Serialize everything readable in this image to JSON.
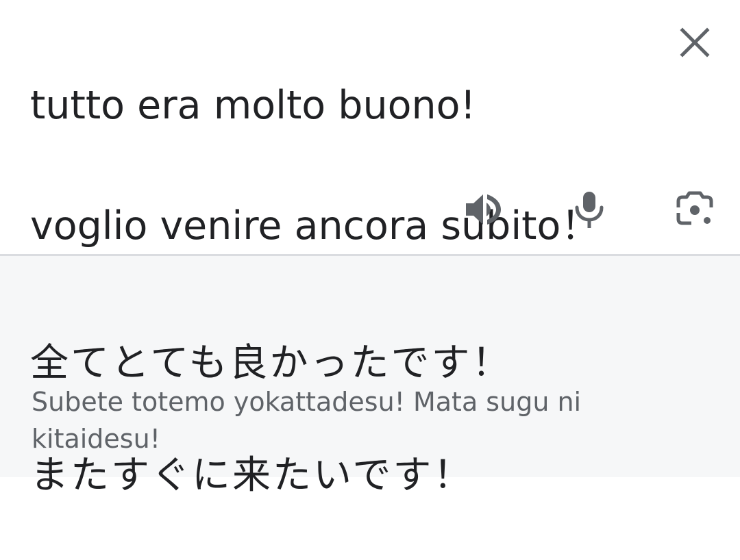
{
  "source": {
    "line1": "tutto era molto buono!",
    "line2": "voglio venire ancora subito！"
  },
  "translation": {
    "line1": "全てとても良かったです！",
    "line2": "またすぐに来たいです！",
    "romanization": "Subete totemo yokattadesu! Mata sugu ni kitaidesu!"
  },
  "icons": {
    "close": "close-icon",
    "speaker": "speaker-icon",
    "mic": "microphone-icon",
    "camera": "camera-icon"
  },
  "colors": {
    "text_primary": "#202124",
    "text_secondary": "#5f6368",
    "icon": "#5f6368",
    "result_background": "#f6f7f8",
    "divider": "#dadce0"
  }
}
